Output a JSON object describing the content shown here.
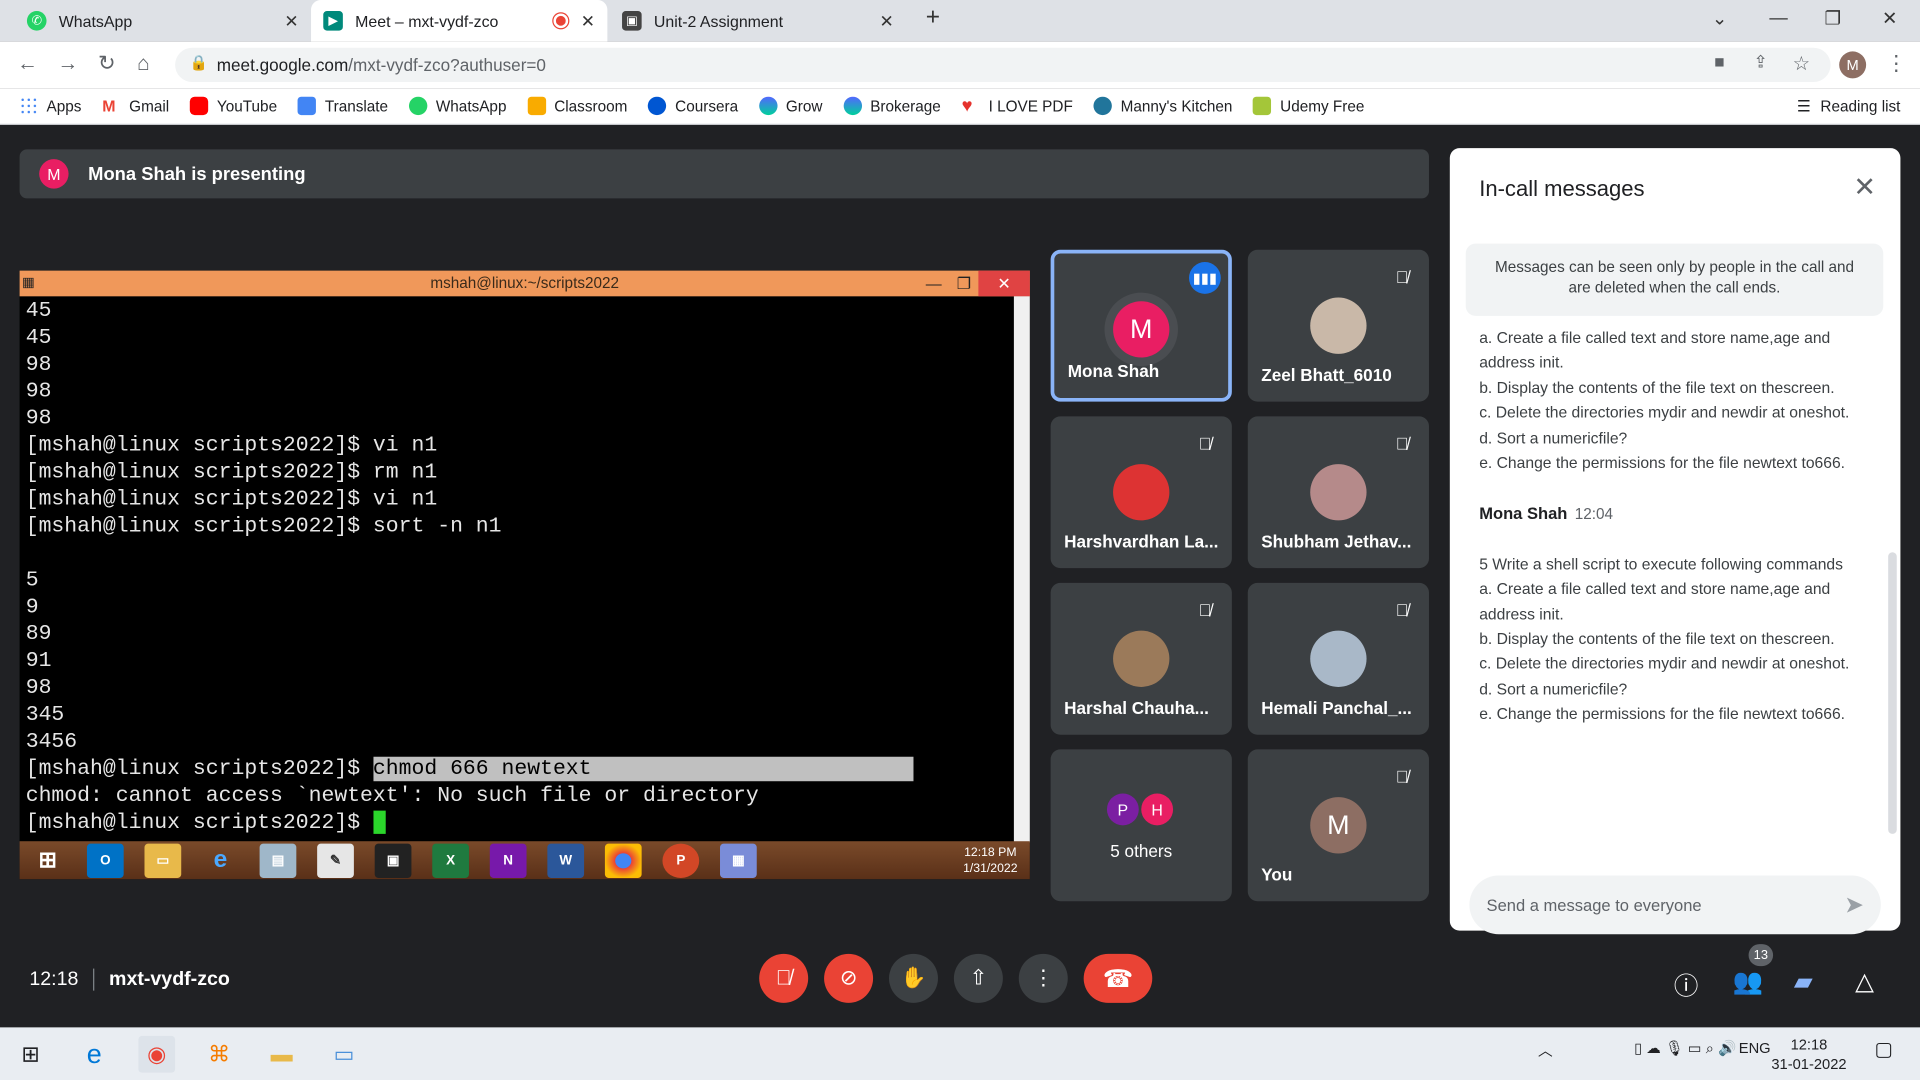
{
  "tabs": [
    {
      "label": "WhatsApp"
    },
    {
      "label": "Meet – mxt-vydf-zco"
    },
    {
      "label": "Unit-2 Assignment"
    }
  ],
  "address": {
    "host": "meet.google.com",
    "path": "/mxt-vydf-zco?authuser=0"
  },
  "profile_initial": "M",
  "bookmarks": [
    "Apps",
    "Gmail",
    "YouTube",
    "Translate",
    "WhatsApp",
    "Classroom",
    "Coursera",
    "Grow",
    "Brokerage",
    "I LOVE PDF",
    "Manny's Kitchen",
    "Udemy Free"
  ],
  "reading_list": "Reading list",
  "presenting": {
    "initial": "M",
    "text": "Mona Shah is presenting"
  },
  "putty": {
    "title": "mshah@linux:~/scripts2022",
    "lines": [
      "45",
      "45",
      "98",
      "98",
      "98",
      "[mshah@linux scripts2022]$ vi n1",
      "[mshah@linux scripts2022]$ rm n1",
      "[mshah@linux scripts2022]$ vi n1",
      "[mshah@linux scripts2022]$ sort -n n1",
      "",
      "5",
      "9",
      "89",
      "91",
      "98",
      "345",
      "3456"
    ],
    "prompt": "[mshah@linux scripts2022]$ ",
    "selected_cmd": "chmod 666 newtext",
    "error": "chmod: cannot access `newtext': No such file or directory",
    "last_prompt": "[mshah@linux scripts2022]$ ",
    "clock_time": "12:18 PM",
    "clock_date": "1/31/2022"
  },
  "participants": [
    {
      "name": "Mona Shah",
      "initial": "M"
    },
    {
      "name": "Zeel Bhatt_6010"
    },
    {
      "name": "Harshvardhan La..."
    },
    {
      "name": "Shubham Jethav..."
    },
    {
      "name": "Harshal Chauha..."
    },
    {
      "name": "Hemali Panchal_..."
    },
    {
      "name": "5 others",
      "initials": [
        "P",
        "H"
      ]
    },
    {
      "name": "You",
      "initial": "M"
    }
  ],
  "panel": {
    "title": "In-call messages",
    "notice": "Messages can be seen only by people in the call and are deleted when the call ends.",
    "items_a": [
      "a. Create a file called text and store name,age and address init.",
      "b. Display the contents of the file text on thescreen.",
      "c. Delete the directories mydir and newdir at oneshot.",
      "d. Sort a numericfile?",
      "e. Change the permissions for the file newtext to666."
    ],
    "sender": "Mona Shah",
    "time": "12:04",
    "msg_intro": "5 Write a shell script to execute following commands",
    "items_b": [
      "a. Create a file called text and store name,age and address init.",
      "b. Display the contents of the file text on thescreen.",
      "c. Delete the directories mydir and newdir at oneshot.",
      "d. Sort a numericfile?",
      "e. Change the permissions for the file newtext to666."
    ],
    "placeholder": "Send a message to everyone"
  },
  "bottom": {
    "time": "12:18",
    "code": "mxt-vydf-zco",
    "people_count": "13"
  },
  "taskbar": {
    "lang": "ENG",
    "time": "12:18",
    "date": "31-01-2022"
  },
  "colors": {
    "accent": "#1a73e8",
    "end": "#ea4335",
    "mona": "#e91e63"
  }
}
